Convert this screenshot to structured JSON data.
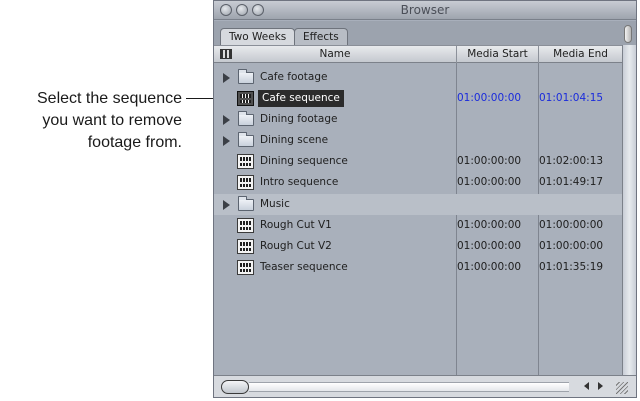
{
  "callout": {
    "lines": [
      "Select the sequence",
      "you want to remove",
      "footage from."
    ]
  },
  "window": {
    "title": "Browser",
    "tabs": [
      {
        "label": "Two Weeks",
        "active": true
      },
      {
        "label": "Effects",
        "active": false
      }
    ],
    "columns": [
      "Name",
      "Media Start",
      "Media End"
    ],
    "rows": [
      {
        "type": "bin",
        "name": "Cafe footage",
        "media_start": "",
        "media_end": ""
      },
      {
        "type": "sequence",
        "name": "Cafe sequence",
        "media_start": "01:00:00:00",
        "media_end": "01:01:04:15",
        "selected": true
      },
      {
        "type": "bin",
        "name": "Dining footage",
        "media_start": "",
        "media_end": ""
      },
      {
        "type": "bin",
        "name": "Dining scene",
        "media_start": "",
        "media_end": ""
      },
      {
        "type": "sequence",
        "name": "Dining sequence",
        "media_start": "01:00:00:00",
        "media_end": "01:02:00:13"
      },
      {
        "type": "sequence",
        "name": "Intro sequence",
        "media_start": "01:00:00:00",
        "media_end": "01:01:49:17"
      },
      {
        "type": "bin",
        "name": "Music",
        "media_start": "",
        "media_end": ""
      },
      {
        "type": "sequence",
        "name": "Rough Cut V1",
        "media_start": "01:00:00:00",
        "media_end": "01:00:00:00"
      },
      {
        "type": "sequence",
        "name": "Rough Cut V2",
        "media_start": "01:00:00:00",
        "media_end": "01:00:00:00"
      },
      {
        "type": "sequence",
        "name": "Teaser sequence",
        "media_start": "01:00:00:00",
        "media_end": "01:01:35:19"
      }
    ],
    "icons": {
      "bin": "folder-icon",
      "sequence": "sequence-icon",
      "disclosure": "disclosure-triangle-icon"
    },
    "colors": {
      "selected_timecode": "#1a2bdc",
      "selection_bg": "#2b2b2b"
    }
  }
}
